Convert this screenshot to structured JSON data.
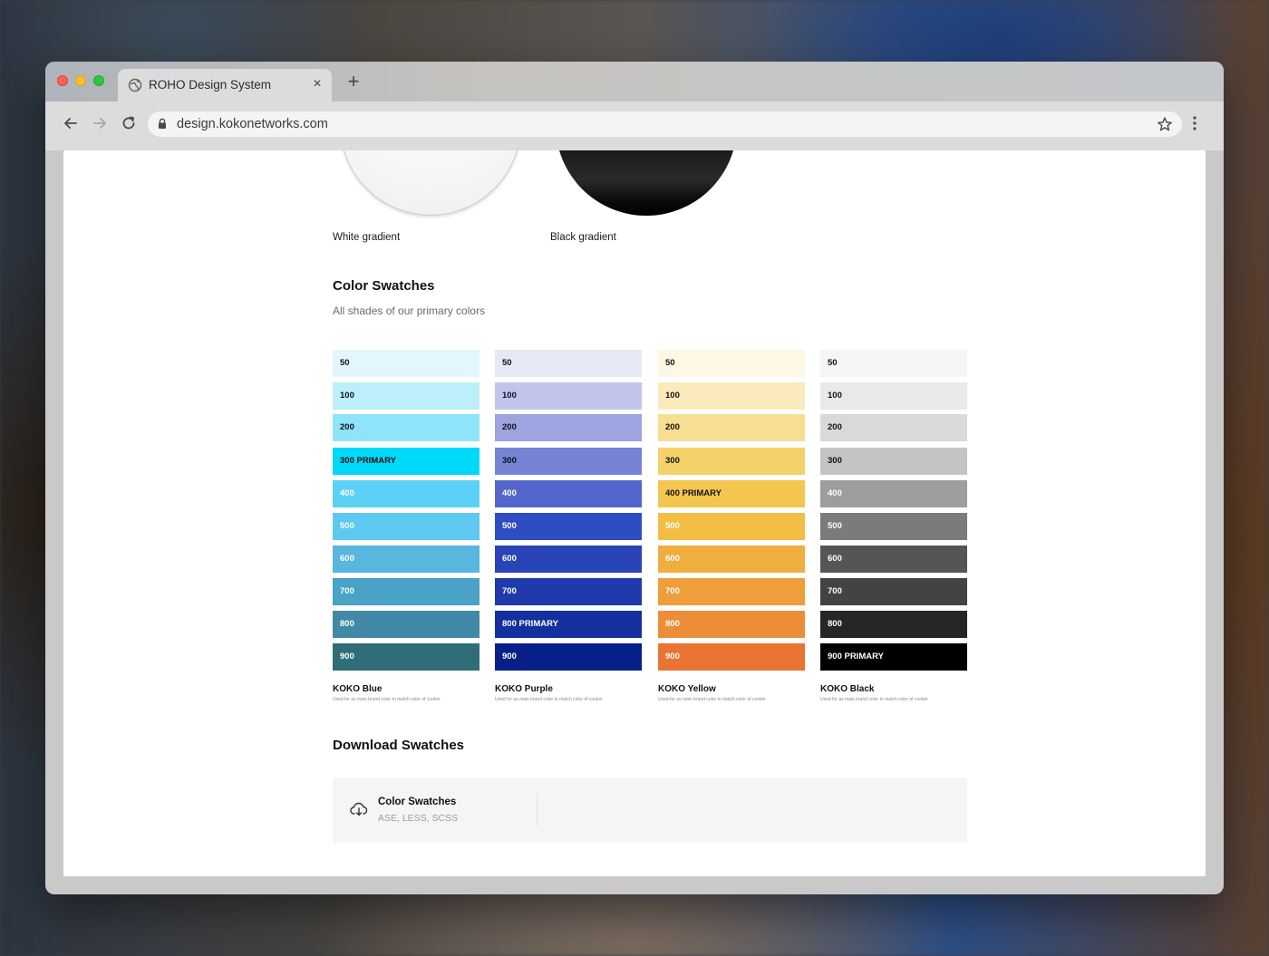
{
  "browser": {
    "tab_title": "ROHO Design System",
    "url": "design.kokonetworks.com"
  },
  "gradients": {
    "white_label": "White gradient",
    "black_label": "Black gradient"
  },
  "color_swatches": {
    "title": "Color Swatches",
    "subtitle": "All shades of our primary colors",
    "palettes": [
      {
        "name": "KOKO Blue",
        "description": "Used for as main brand color to match color of cooker",
        "shades": [
          {
            "label": "50",
            "color": "#e3f6fd",
            "text": "#111111"
          },
          {
            "label": "100",
            "color": "#bdeffb",
            "text": "#111111"
          },
          {
            "label": "200",
            "color": "#90e4f9",
            "text": "#111111"
          },
          {
            "label": "300 PRIMARY",
            "color": "#00d8f8",
            "text": "#111111"
          },
          {
            "label": "400",
            "color": "#5bd2f5",
            "text": "#ffffff"
          },
          {
            "label": "500",
            "color": "#5ec8f0",
            "text": "#ffffff"
          },
          {
            "label": "600",
            "color": "#58b6df",
            "text": "#ffffff"
          },
          {
            "label": "700",
            "color": "#4aa2c6",
            "text": "#ffffff"
          },
          {
            "label": "800",
            "color": "#4189a6",
            "text": "#ffffff"
          },
          {
            "label": "900",
            "color": "#2f6d78",
            "text": "#ffffff"
          }
        ]
      },
      {
        "name": "KOKO Purple",
        "description": "Used for as main brand color to match color of cooker",
        "shades": [
          {
            "label": "50",
            "color": "#e6e8f6",
            "text": "#111111"
          },
          {
            "label": "100",
            "color": "#c2c5eb",
            "text": "#111111"
          },
          {
            "label": "200",
            "color": "#9da4e0",
            "text": "#111111"
          },
          {
            "label": "300",
            "color": "#7683d5",
            "text": "#111111"
          },
          {
            "label": "400",
            "color": "#5466cb",
            "text": "#ffffff"
          },
          {
            "label": "500",
            "color": "#2e4dc2",
            "text": "#ffffff"
          },
          {
            "label": "600",
            "color": "#2944b7",
            "text": "#ffffff"
          },
          {
            "label": "700",
            "color": "#1f3aab",
            "text": "#ffffff"
          },
          {
            "label": "800 PRIMARY",
            "color": "#14309e",
            "text": "#ffffff"
          },
          {
            "label": "900",
            "color": "#071f88",
            "text": "#ffffff"
          }
        ]
      },
      {
        "name": "KOKO Yellow",
        "description": "Used for as main brand color to match color of cooker",
        "shades": [
          {
            "label": "50",
            "color": "#fdf7e5",
            "text": "#111111"
          },
          {
            "label": "100",
            "color": "#fbebbc",
            "text": "#111111"
          },
          {
            "label": "200",
            "color": "#f8de92",
            "text": "#111111"
          },
          {
            "label": "300",
            "color": "#f5d169",
            "text": "#111111"
          },
          {
            "label": "400 PRIMARY",
            "color": "#f3c64f",
            "text": "#111111"
          },
          {
            "label": "500",
            "color": "#f2bd43",
            "text": "#ffffff"
          },
          {
            "label": "600",
            "color": "#f0ae3f",
            "text": "#ffffff"
          },
          {
            "label": "700",
            "color": "#ef9e3c",
            "text": "#ffffff"
          },
          {
            "label": "800",
            "color": "#ed8d38",
            "text": "#ffffff"
          },
          {
            "label": "900",
            "color": "#e97331",
            "text": "#ffffff"
          }
        ]
      },
      {
        "name": "KOKO Black",
        "description": "Used for as main brand color to match color of cooker",
        "shades": [
          {
            "label": "50",
            "color": "#f5f5f5",
            "text": "#111111"
          },
          {
            "label": "100",
            "color": "#e9e9e9",
            "text": "#111111"
          },
          {
            "label": "200",
            "color": "#d9d9d9",
            "text": "#111111"
          },
          {
            "label": "300",
            "color": "#c4c4c4",
            "text": "#111111"
          },
          {
            "label": "400",
            "color": "#9d9d9d",
            "text": "#ffffff"
          },
          {
            "label": "500",
            "color": "#7b7b7b",
            "text": "#ffffff"
          },
          {
            "label": "600",
            "color": "#555555",
            "text": "#ffffff"
          },
          {
            "label": "700",
            "color": "#434343",
            "text": "#ffffff"
          },
          {
            "label": "800",
            "color": "#262626",
            "text": "#ffffff"
          },
          {
            "label": "900 PRIMARY",
            "color": "#000000",
            "text": "#ffffff"
          }
        ]
      }
    ]
  },
  "download": {
    "title": "Download Swatches",
    "card_title": "Color Swatches",
    "card_formats": "ASE, LESS, SCSS"
  },
  "icons": {
    "tab": "globe-icon",
    "close": "close-icon",
    "new_tab": "plus-icon",
    "back": "arrow-left-icon",
    "forward": "arrow-right-icon",
    "reload": "reload-icon",
    "secure": "lock-icon",
    "bookmark": "star-icon",
    "menu": "kebab-menu-icon",
    "download": "cloud-download-icon"
  }
}
